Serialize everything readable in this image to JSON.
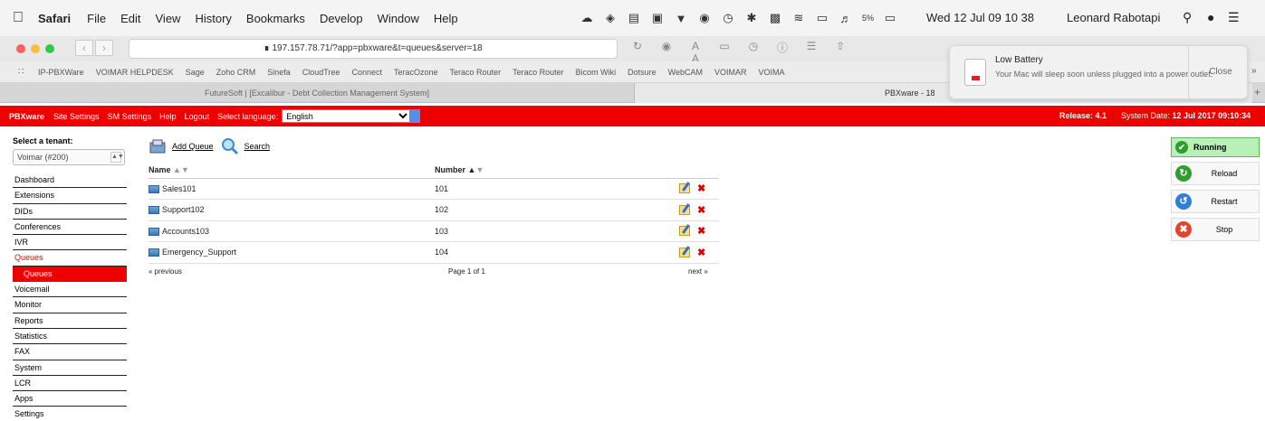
{
  "mac_menu": {
    "app": "Safari",
    "items": [
      "File",
      "Edit",
      "View",
      "History",
      "Bookmarks",
      "Develop",
      "Window",
      "Help"
    ],
    "battery": "5%",
    "clock": "Wed 12 Jul  09 10 38",
    "user": "Leonard Rabotapi"
  },
  "browser": {
    "url": "197.157.78.71/?app=pbxware&t=queues&server=18",
    "bookmarks": [
      "IP-PBXWare",
      "VOIMAR HELPDESK",
      "Sage",
      "Zoho CRM",
      "Sinefa",
      "CloudTree",
      "Connect",
      "TeracOzone",
      "Teraco Router",
      "Teraco Router",
      "Bicom Wiki",
      "Dotsure",
      "WebCAM",
      "VOIMAR",
      "VOIMA"
    ],
    "tabs": [
      "FutureSoft | [Excalibur - Debt Collection Management System]",
      "PBXware - 18"
    ]
  },
  "notification": {
    "title": "Low Battery",
    "body": "Your Mac will sleep soon unless plugged into a power outlet.",
    "close": "Close"
  },
  "appbar": {
    "brand": "PBXware",
    "links": [
      "Site Settings",
      "SM Settings",
      "Help",
      "Logout"
    ],
    "language_label": "Select language:",
    "language": "English",
    "release": "Release: 4.1",
    "system_date_label": "System Date:",
    "system_date": "12 Jul 2017 09:10:34"
  },
  "sidebar": {
    "tenant_label": "Select a tenant:",
    "tenant": "Voimar (#200)",
    "items": [
      "Dashboard",
      "Extensions",
      "DIDs",
      "Conferences",
      "IVR",
      "Queues",
      "Queues",
      "Voicemail",
      "Monitor",
      "Reports",
      "Statistics",
      "FAX",
      "System",
      "LCR",
      "Apps",
      "Settings"
    ]
  },
  "actions": {
    "add": "Add Queue",
    "search": "Search"
  },
  "table": {
    "columns": [
      "Name",
      "Number"
    ],
    "rows": [
      {
        "name": "Sales101",
        "number": "101"
      },
      {
        "name": "Support102",
        "number": "102"
      },
      {
        "name": "Accounts103",
        "number": "103"
      },
      {
        "name": "Emergency_Support",
        "number": "104"
      }
    ],
    "prev": "« previous",
    "page": "Page 1 of 1",
    "next": "next »"
  },
  "status": {
    "running": "Running",
    "reload": "Reload",
    "restart": "Restart",
    "stop": "Stop"
  },
  "colors": {
    "brand_red": "#ee0000",
    "running_green": "#b8f0b8"
  }
}
